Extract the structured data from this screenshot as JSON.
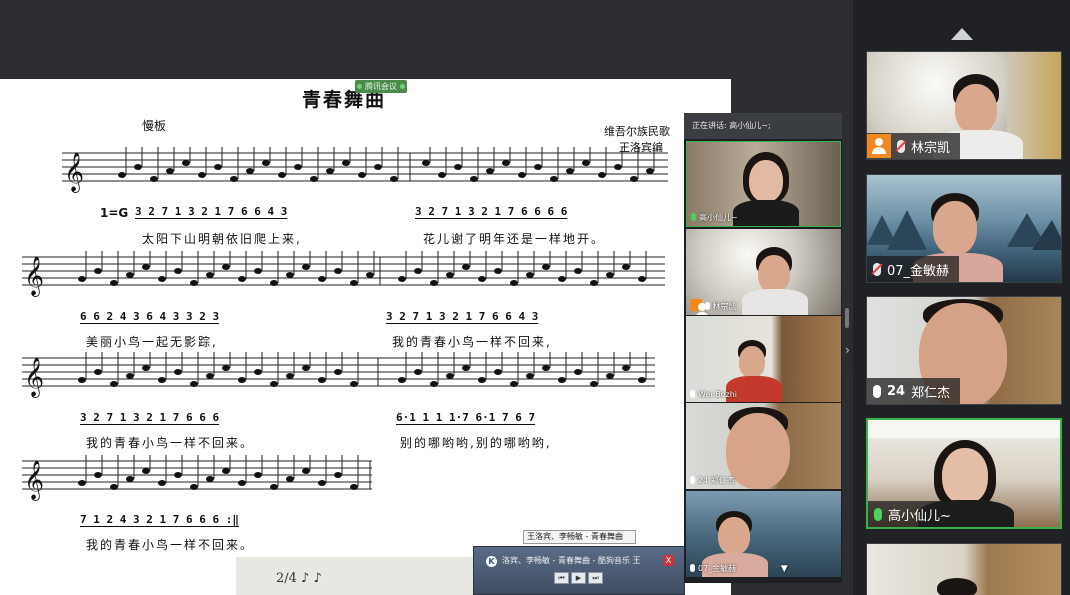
{
  "share": {
    "tag": "腾讯会议"
  },
  "sheet": {
    "title": "青春舞曲",
    "tempo": "慢板",
    "composer_line1": "维吾尔族民歌",
    "composer_line2": "王洛宾编",
    "key": "1=G",
    "rows": [
      {
        "jianpu": [
          " 3 2 7 1  3 2 1 7  6  6 4  3",
          " 3 2 7 1  3 2 1 7  6  6 6  6"
        ],
        "lyrics": [
          "太阳下山明朝依旧爬上来,",
          "花儿谢了明年还是一样地开。"
        ]
      },
      {
        "jianpu": [
          " 6 6 2 4  3   6 4  3   3 2  3",
          " 3 2 7 1  3 2 1 7  6  6 4  3"
        ],
        "lyrics": [
          "美丽小鸟一起无影踪,",
          "我的青春小鸟一样不回来,"
        ]
      },
      {
        "jianpu": [
          " 3 2 7 1  3 2 1 7  6  6  6",
          " 6·1 1 1  1·7  6·1 7 6  7"
        ],
        "lyrics": [
          "我的青春小鸟一样不回来。",
          "别的哪哟哟,别的哪哟哟,"
        ]
      },
      {
        "jianpu": [
          " 7 1 2 4  3 2 1 7  6  6  6   :‖"
        ],
        "lyrics": [
          "我的青春小鸟一样不回来。"
        ]
      }
    ],
    "paper_text": "2/4  ♪  ♪"
  },
  "media": {
    "tooltip": "王洛宾、李畅敏 - 青春舞曲",
    "track": "洛宾、李畅敏 - 青春舞曲 - 酷狗音乐 王",
    "logo": "K",
    "close": "X"
  },
  "float_panel": {
    "speaking": "正在讲话: 高小仙儿~;",
    "tiles": [
      {
        "name": "高小仙儿~"
      },
      {
        "name": "林宗凯"
      },
      {
        "name": "Wei Bozhi"
      },
      {
        "name": "24   郑仁杰"
      },
      {
        "name": "07_金敏赫"
      }
    ]
  },
  "sidebar": {
    "participants": [
      {
        "name": "林宗凯",
        "mic": "muted",
        "badge": true
      },
      {
        "name": "07_金敏赫",
        "mic": "muted"
      },
      {
        "num": "24",
        "name": "郑仁杰",
        "mic": "on"
      },
      {
        "name": "高小仙儿~",
        "mic": "speaking",
        "active": true
      }
    ]
  },
  "colors": {
    "active_border": "#3ab24a",
    "mic_active": "#4ecf61",
    "badge_orange": "#f08a1f",
    "app_bg": "#2b2d30"
  }
}
